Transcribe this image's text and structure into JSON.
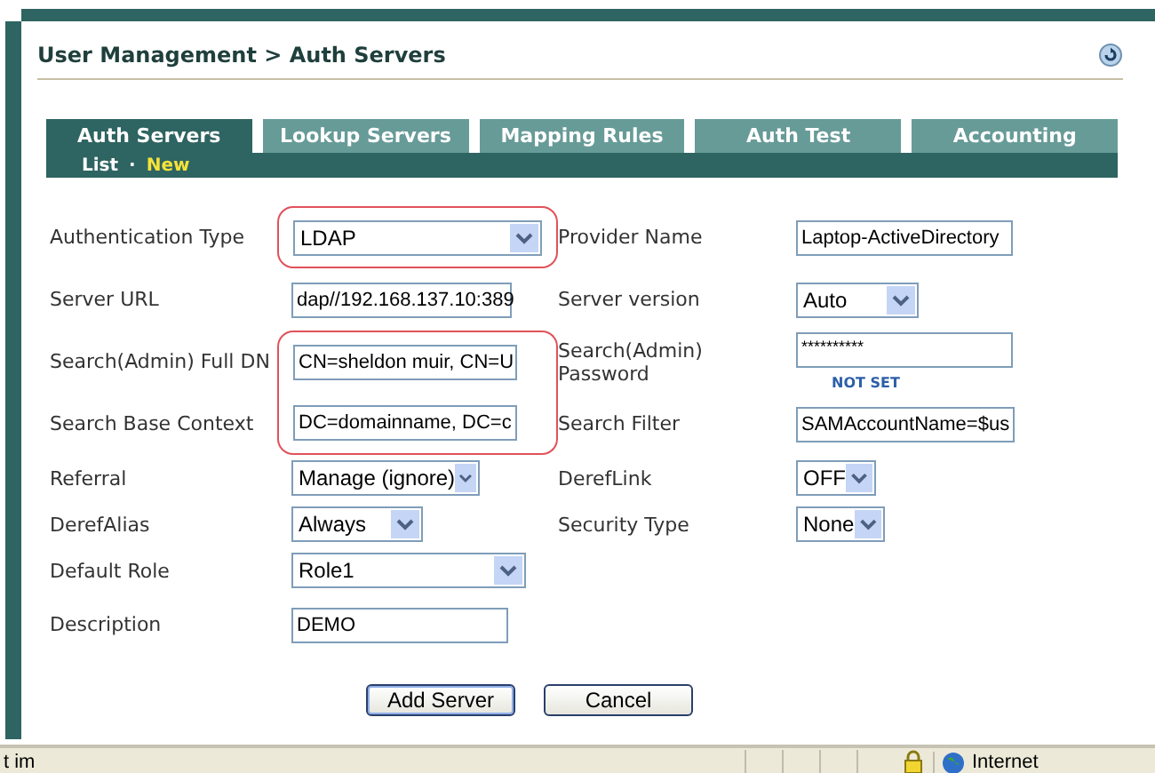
{
  "page": {
    "title": "User Management > Auth Servers"
  },
  "tabs": [
    {
      "label": "Auth Servers",
      "selected": true
    },
    {
      "label": "Lookup Servers",
      "selected": false
    },
    {
      "label": "Mapping Rules",
      "selected": false
    },
    {
      "label": "Auth Test",
      "selected": false
    },
    {
      "label": "Accounting",
      "selected": false
    }
  ],
  "subnav": [
    {
      "label": "List",
      "selected": false
    },
    {
      "label": "New",
      "selected": true
    }
  ],
  "subnav_separator": "·",
  "form_rows": [
    {
      "left": {
        "label": "Authentication Type",
        "kind": "select",
        "value": "LDAP",
        "highlighted": true
      },
      "right": {
        "label": "Provider Name",
        "kind": "text",
        "value": "Laptop-ActiveDirectory",
        "highlighted": false
      }
    },
    {
      "left": {
        "label": "Server URL",
        "kind": "text",
        "value": "dap//192.168.137.10:389",
        "highlighted": false
      },
      "right": {
        "label": "Server version",
        "kind": "select",
        "value": "Auto",
        "highlighted": false
      }
    },
    {
      "left": {
        "label": "Search(Admin) Full DN",
        "kind": "text",
        "value": "CN=sheldon muir, CN=U",
        "highlighted": true
      },
      "right": {
        "label": "Search(Admin) Password",
        "kind": "password",
        "value": "**********",
        "note": "NOT SET",
        "highlighted": false
      }
    },
    {
      "left": {
        "label": "Search Base Context",
        "kind": "text",
        "value": "DC=domainname, DC=c",
        "highlighted": true
      },
      "right": {
        "label": "Search Filter",
        "kind": "text",
        "value": "SAMAccountName=$us",
        "highlighted": false
      }
    },
    {
      "left": {
        "label": "Referral",
        "kind": "select",
        "value": "Manage (ignore)",
        "highlighted": false
      },
      "right": {
        "label": "DerefLink",
        "kind": "select",
        "value": "OFF",
        "highlighted": false
      }
    },
    {
      "left": {
        "label": "DerefAlias",
        "kind": "select",
        "value": "Always",
        "highlighted": false
      },
      "right": {
        "label": "Security Type",
        "kind": "select",
        "value": "None",
        "highlighted": false
      }
    },
    {
      "left": {
        "label": "Default Role",
        "kind": "select",
        "value": "Role1",
        "highlighted": false
      }
    },
    {
      "left": {
        "label": "Description",
        "kind": "text",
        "value": "DEMO",
        "highlighted": false
      }
    }
  ],
  "buttons": [
    "Add Server",
    "Cancel"
  ],
  "status_bar": {
    "text": "t im",
    "zone": "Internet"
  }
}
